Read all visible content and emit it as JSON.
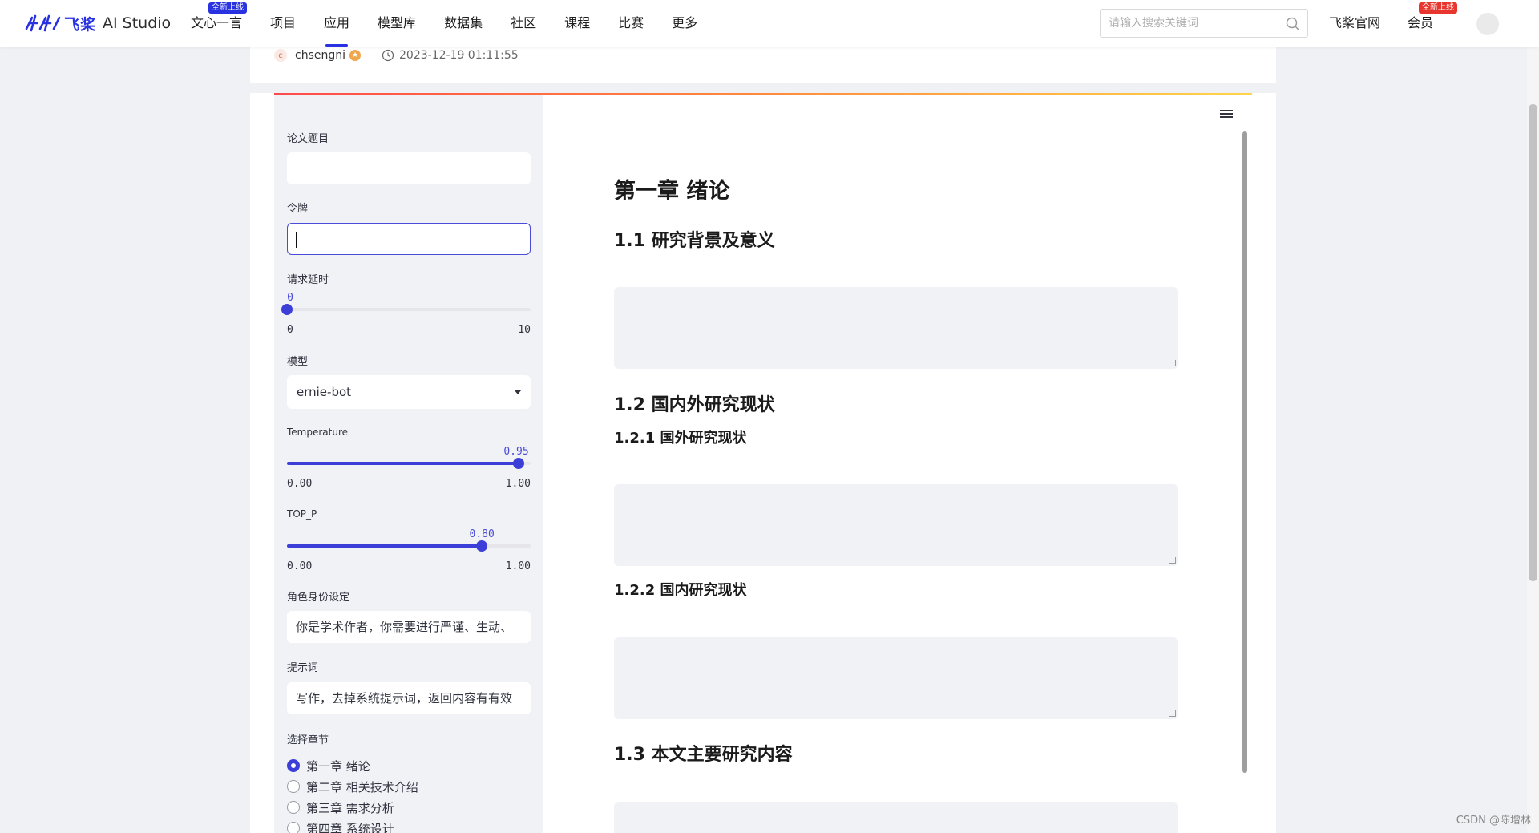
{
  "nav": {
    "logo_cn": "飞桨",
    "logo_en": "AI Studio",
    "items": [
      {
        "label": "文心一言",
        "badge": "全新上线"
      },
      {
        "label": "项目"
      },
      {
        "label": "应用"
      },
      {
        "label": "模型库"
      },
      {
        "label": "数据集"
      },
      {
        "label": "社区"
      },
      {
        "label": "课程"
      },
      {
        "label": "比赛"
      },
      {
        "label": "更多"
      }
    ],
    "active_item": "应用",
    "search_placeholder": "请输入搜索关键词",
    "official_site": "飞桨官网",
    "member": "会员",
    "member_badge": "全新上线"
  },
  "author": {
    "avatar_letter": "c",
    "name": "chsengni",
    "datetime": "2023-12-19 01:11:55"
  },
  "sidebar": {
    "title_label": "论文题目",
    "title_value": "",
    "token_label": "令牌",
    "token_value": "",
    "delay_label": "请求延时",
    "delay": {
      "value": "0",
      "min": "0",
      "max": "10",
      "fraction": 0.0
    },
    "model_label": "模型",
    "model_value": "ernie-bot",
    "temperature_label": "Temperature",
    "temperature": {
      "value": "0.95",
      "min": "0.00",
      "max": "1.00",
      "fraction": 0.95
    },
    "top_p_label": "TOP_P",
    "top_p": {
      "value": "0.80",
      "min": "0.00",
      "max": "1.00",
      "fraction": 0.8
    },
    "role_label": "角色身份设定",
    "role_value": "你是学术作者，你需要进行严谨、生动、",
    "prompt_label": "提示词",
    "prompt_value": "写作，去掉系统提示词，返回内容有有效",
    "chapter_label": "选择章节",
    "chapters": [
      {
        "label": "第一章 绪论",
        "checked": true
      },
      {
        "label": "第二章 相关技术介绍",
        "checked": false
      },
      {
        "label": "第三章 需求分析",
        "checked": false
      },
      {
        "label": "第四章 系统设计",
        "checked": false
      }
    ]
  },
  "content": {
    "chapter_title": "第一章 绪论",
    "s1": "1.1 研究背景及意义",
    "s2": "1.2 国内外研究现状",
    "s2_1": "1.2.1 国外研究现状",
    "s2_2": "1.2.2 国内研究现状",
    "s3": "1.3 本文主要研究内容"
  },
  "watermark": "CSDN @陈增林",
  "colors": {
    "brand": "#2932e1",
    "accent": "#3b3fd8",
    "badge_red": "#e8352d"
  }
}
